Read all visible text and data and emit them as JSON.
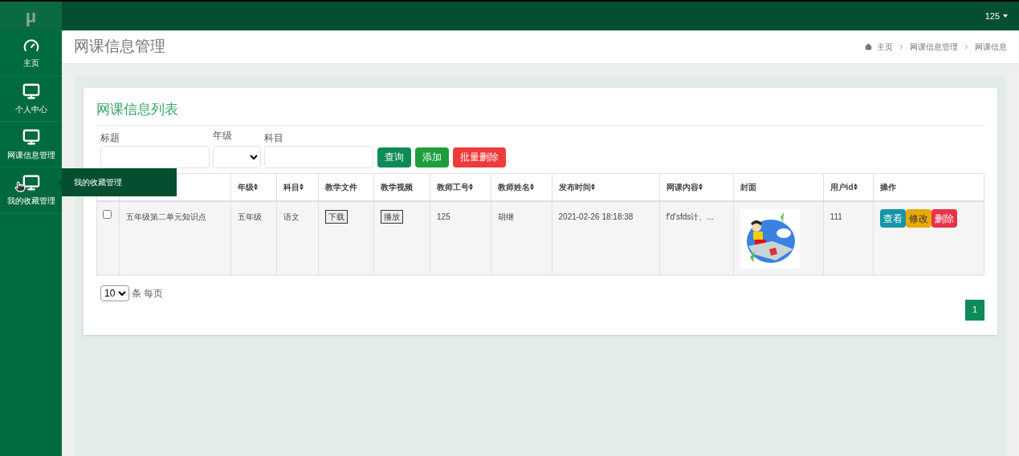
{
  "logo": "μ",
  "user_menu": {
    "label": "125"
  },
  "sidebar": {
    "items": [
      {
        "label": "主页",
        "kind": "dashboard",
        "hovered": false
      },
      {
        "label": "个人中心",
        "kind": "monitor",
        "hovered": false
      },
      {
        "label": "网课信息管理",
        "kind": "monitor",
        "hovered": false
      },
      {
        "label": "我的收藏管理",
        "kind": "monitor",
        "hovered": true
      }
    ]
  },
  "tooltip": {
    "text": "我的收藏管理"
  },
  "page_title": "网课信息管理",
  "breadcrumb": [
    "主页",
    "网课信息管理",
    "网课信息"
  ],
  "card_title": "网课信息列表",
  "filters": [
    {
      "label": "标题",
      "kind": "text"
    },
    {
      "label": "年级",
      "kind": "select"
    },
    {
      "label": "科目",
      "kind": "text"
    }
  ],
  "actions": [
    {
      "label": "查询",
      "kind": "search"
    },
    {
      "label": "添加",
      "kind": "add"
    },
    {
      "label": "批量删除",
      "kind": "delete"
    }
  ],
  "table": {
    "columns": [
      {
        "label": "年级",
        "sortable": true
      },
      {
        "label": "科目",
        "sortable": true
      },
      {
        "label": "教学文件",
        "sortable": false
      },
      {
        "label": "教学视频",
        "sortable": false
      },
      {
        "label": "教师工号",
        "sortable": true
      },
      {
        "label": "教师姓名",
        "sortable": true
      },
      {
        "label": "发布时间",
        "sortable": true
      },
      {
        "label": "网课内容",
        "sortable": true
      },
      {
        "label": "封面",
        "sortable": false
      },
      {
        "label": "用户id",
        "sortable": true
      },
      {
        "label": "操作",
        "sortable": false
      }
    ],
    "rows": [
      {
        "checked": false,
        "title": "五年级第二单元知识点",
        "grade": "五年级",
        "subject": "语文",
        "file_button": "下载",
        "video_button": "播放",
        "teacher_id": "125",
        "teacher_name": "胡继",
        "time": "2021-02-26 18:18:38",
        "content": "f'd'sfds计、...",
        "cover": {
          "kind": "picture"
        },
        "user_id": "111",
        "buttons": [
          {
            "label": "查看",
            "kind": "view"
          },
          {
            "label": "修改",
            "kind": "edit"
          },
          {
            "label": "删除",
            "kind": "delete"
          }
        ]
      }
    ]
  },
  "page_size": {
    "value": "10",
    "label": "条 每页"
  },
  "pagination": [
    {
      "label": "1",
      "selected": true
    }
  ]
}
